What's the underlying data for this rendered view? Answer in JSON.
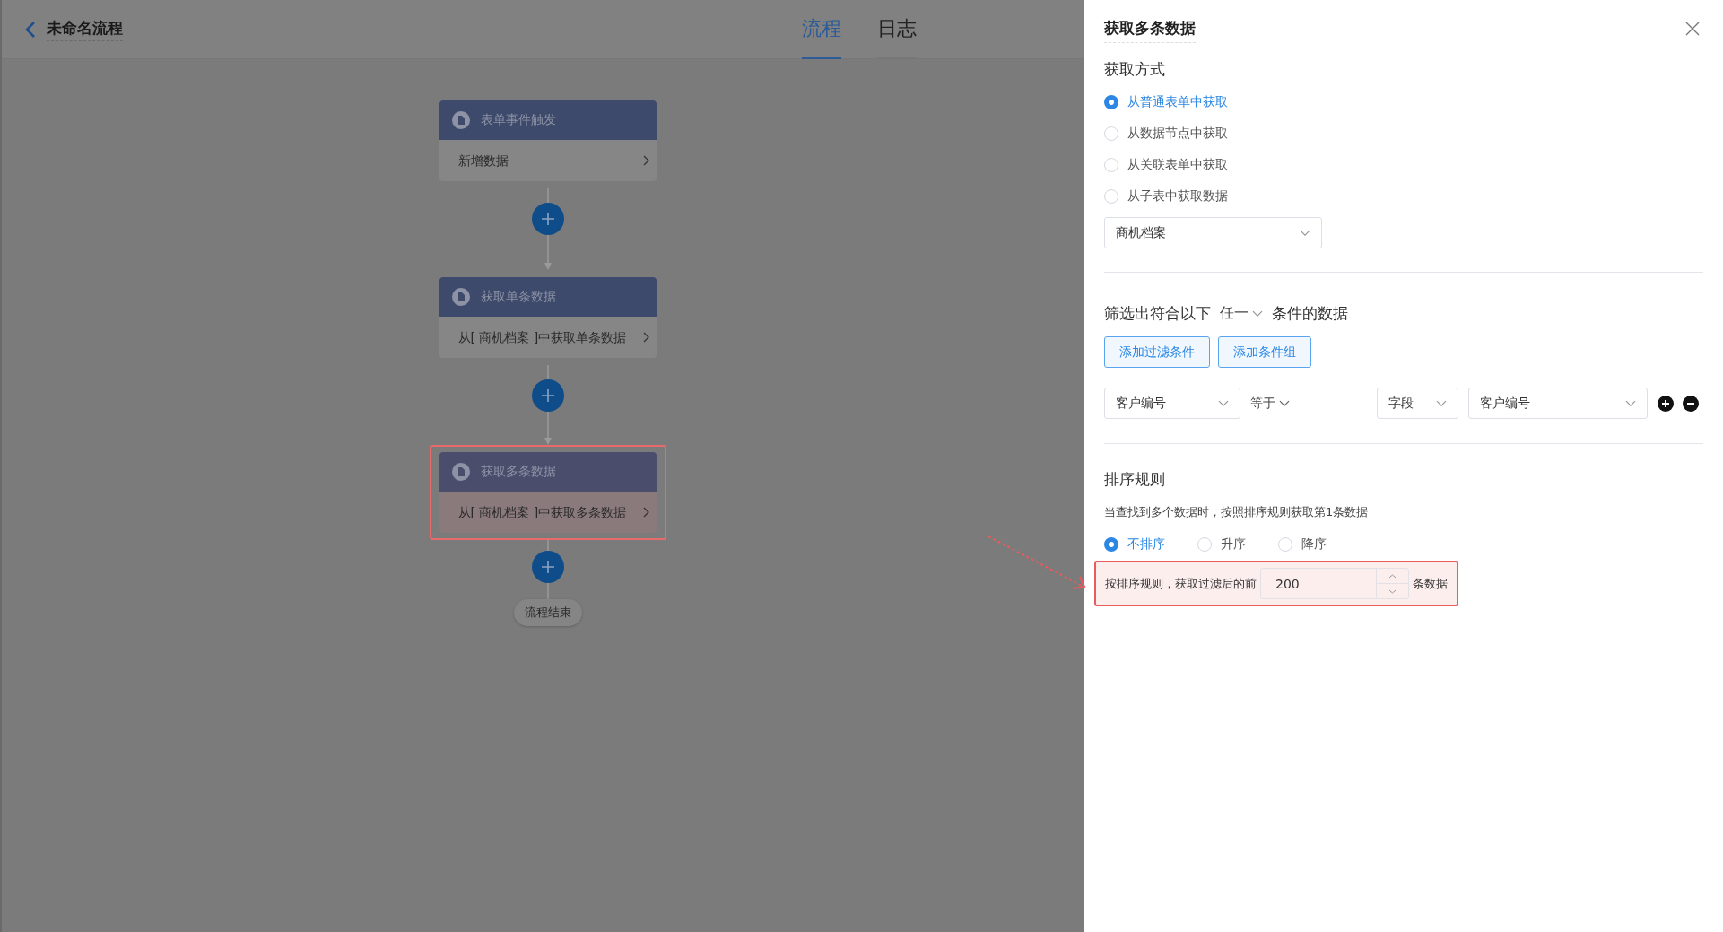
{
  "header": {
    "title": "未命名流程",
    "tabs": [
      {
        "label": "流程",
        "selected": true
      },
      {
        "label": "日志",
        "selected": false
      }
    ]
  },
  "flow": {
    "nodes": [
      {
        "title": "表单事件触发",
        "detail": "新增数据",
        "selected": false
      },
      {
        "title": "获取单条数据",
        "detail": "从[ 商机档案 ]中获取单条数据",
        "selected": false
      },
      {
        "title": "获取多条数据",
        "detail": "从[ 商机档案 ]中获取多条数据",
        "selected": true
      }
    ],
    "end": "流程结束"
  },
  "panel": {
    "title": "获取多条数据",
    "source": {
      "label": "获取方式",
      "options": [
        {
          "label": "从普通表单中获取",
          "selected": true
        },
        {
          "label": "从数据节点中获取",
          "selected": false
        },
        {
          "label": "从关联表单中获取",
          "selected": false
        },
        {
          "label": "从子表中获取数据",
          "selected": false
        }
      ],
      "form_select": "商机档案"
    },
    "filter": {
      "prefix": "筛选出符合以下",
      "match": "任一",
      "suffix": "条件的数据",
      "buttons": [
        "添加过滤条件",
        "添加条件组"
      ],
      "condition": {
        "field": "客户编号",
        "operator": "等于",
        "value_type": "字段",
        "value": "客户编号"
      }
    },
    "sort": {
      "label": "排序规则",
      "hint": "当查找到多个数据时，按照排序规则获取第1条数据",
      "options": [
        {
          "label": "不排序",
          "selected": true
        },
        {
          "label": "升序",
          "selected": false
        },
        {
          "label": "降序",
          "selected": false
        }
      ],
      "limit": {
        "prefix": "按排序规则，获取过滤后的前",
        "value": "200",
        "suffix": "条数据"
      }
    }
  }
}
